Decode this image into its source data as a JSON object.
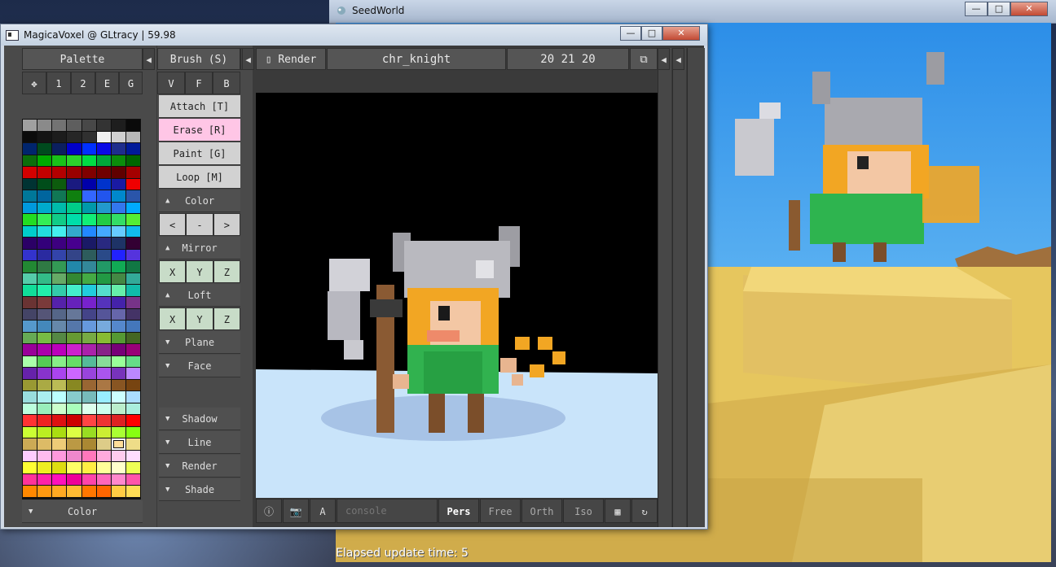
{
  "seedworld": {
    "title": "SeedWorld",
    "status": "Elapsed update time: 5",
    "controls": {
      "minimize": "—",
      "maximize": "□",
      "close": "✕"
    }
  },
  "magicavoxel": {
    "title": "MagicaVoxel @ GLtracy | 59.98",
    "controls": {
      "minimize": "—",
      "maximize": "□",
      "close": "✕"
    },
    "palette": {
      "header": "Palette",
      "tabs": [
        "1",
        "2",
        "E",
        "G"
      ],
      "footer": "Color",
      "selected_index": 222,
      "colors": [
        "#a0a0a0",
        "#8a8a8a",
        "#737373",
        "#5e5e5e",
        "#484848",
        "#333333",
        "#1e1e1e",
        "#0a0a0a",
        "#0b0b0b",
        "#141414",
        "#1c1c1c",
        "#262626",
        "#303030",
        "#f0f0f0",
        "#d0d0d0",
        "#b8b8b8",
        "#00256d",
        "#004a1e",
        "#0b1f5e",
        "#0000c8",
        "#0030ff",
        "#0a0ae6",
        "#1e2d8c",
        "#001a99",
        "#0b6e0b",
        "#00aa00",
        "#19c219",
        "#2bd22b",
        "#00dd44",
        "#00a83a",
        "#0b8c0b",
        "#006600",
        "#d40000",
        "#c40000",
        "#b30000",
        "#990000",
        "#800000",
        "#700000",
        "#600000",
        "#a40000",
        "#003333",
        "#004d1a",
        "#0d5c0d",
        "#1a1a80",
        "#0000aa",
        "#0033cc",
        "#1a1aa3",
        "#f00000",
        "#007799",
        "#00659e",
        "#117755",
        "#0f7f0f",
        "#3366ff",
        "#2255ee",
        "#0088cc",
        "#2a55aa",
        "#0099dd",
        "#00aacc",
        "#00bbaa",
        "#00cc88",
        "#0099aa",
        "#2299cc",
        "#3377ee",
        "#00aaff",
        "#22dd22",
        "#33ee55",
        "#11cc88",
        "#00ddaa",
        "#11ee77",
        "#22cc44",
        "#33dd66",
        "#55ee33",
        "#00cccc",
        "#22dddd",
        "#44eeee",
        "#33aacc",
        "#2288ff",
        "#44aaff",
        "#66ccff",
        "#11bbee",
        "#2b0066",
        "#33007a",
        "#3d0080",
        "#47008f",
        "#1a1a66",
        "#292980",
        "#1e3366",
        "#330033",
        "#3333cc",
        "#2a2aa0",
        "#3344aa",
        "#334488",
        "#2d5c5c",
        "#2a4a88",
        "#2222ff",
        "#5533dd",
        "#228833",
        "#2f7a44",
        "#339955",
        "#2288aa",
        "#338899",
        "#229966",
        "#11aa55",
        "#117744",
        "#55ccaa",
        "#33bb88",
        "#66aa66",
        "#338833",
        "#44aa44",
        "#229944",
        "#448844",
        "#33aa99",
        "#11dd99",
        "#22eeaa",
        "#33ccaa",
        "#44eecc",
        "#22ccdd",
        "#55ddcc",
        "#66eeaa",
        "#11bbaa",
        "#6a3333",
        "#7a3a3a",
        "#5522aa",
        "#6622bb",
        "#7722cc",
        "#5533bb",
        "#4422aa",
        "#773388",
        "#444466",
        "#555577",
        "#556688",
        "#667799",
        "#444488",
        "#555599",
        "#6666aa",
        "#443366",
        "#5599cc",
        "#4488bb",
        "#6688aa",
        "#5577aa",
        "#6699dd",
        "#77aadd",
        "#5588cc",
        "#4477bb",
        "#66aa55",
        "#77bb44",
        "#558844",
        "#669933",
        "#77aa44",
        "#88bb33",
        "#559933",
        "#446622",
        "#990099",
        "#aa00aa",
        "#bb00bb",
        "#cc22cc",
        "#aa22aa",
        "#882288",
        "#770077",
        "#990077",
        "#aaffaa",
        "#55cc55",
        "#88ee88",
        "#66dd66",
        "#55bb99",
        "#88dd99",
        "#99ff99",
        "#66dd88",
        "#6622aa",
        "#8833cc",
        "#aa44ee",
        "#cc66ff",
        "#9944dd",
        "#aa55ee",
        "#7733bb",
        "#bb88ff",
        "#999933",
        "#aaaa44",
        "#bbbb55",
        "#888822",
        "#996633",
        "#aa7744",
        "#885522",
        "#774411",
        "#99dddd",
        "#aaeeee",
        "#bbffff",
        "#88cccc",
        "#77bbbb",
        "#99eeff",
        "#ccffff",
        "#aaddff",
        "#bbffdd",
        "#99eebb",
        "#ccffcc",
        "#aaffbb",
        "#ddffee",
        "#ccffee",
        "#bbeecc",
        "#aaeedd",
        "#ff3333",
        "#ee2222",
        "#dd1111",
        "#cc0000",
        "#ff4444",
        "#ee3333",
        "#dd2222",
        "#ff0000",
        "#ccff33",
        "#bbee22",
        "#aadd11",
        "#ddff44",
        "#99dd22",
        "#ccee33",
        "#aaff33",
        "#88ff11",
        "#ccaa55",
        "#ddbb66",
        "#eecc77",
        "#bb9944",
        "#aa8833",
        "#ddcc88",
        "#ffdd99",
        "#eedd88",
        "#ffccff",
        "#ffbbee",
        "#ff99dd",
        "#ee88cc",
        "#ff77bb",
        "#ffaadd",
        "#ffccee",
        "#ffddff",
        "#ffff33",
        "#eeee22",
        "#dddd11",
        "#ffff66",
        "#ffee44",
        "#ffff99",
        "#ffffcc",
        "#eeff55",
        "#ff3399",
        "#ff22aa",
        "#ff11bb",
        "#ee0099",
        "#ff44aa",
        "#ff66bb",
        "#ff88cc",
        "#ff55aa",
        "#ff8800",
        "#ff9911",
        "#ffaa22",
        "#ffbb33",
        "#ff7700",
        "#ff6600",
        "#ffcc44",
        "#ffdd55",
        "#ff6666",
        "#ff7777",
        "#ff8888",
        "#ff5555",
        "#ee6666",
        "#ff9999",
        "#ffaaaa",
        "#ffbbbb",
        "#ffe0b0",
        "#ffd08a",
        "#ffc070",
        "#ffb050",
        "#ffe8c0",
        "#fff0d0",
        "#fff8e0",
        "#fff8f0"
      ]
    },
    "brush": {
      "header": "Brush (S)",
      "tabs": [
        "V",
        "F",
        "B"
      ],
      "modes": [
        "Attach [T]",
        "Erase  [R]",
        "Paint  [G]",
        "Loop   [M]"
      ],
      "color": {
        "label": "Color",
        "buttons": [
          "<",
          "-",
          ">"
        ]
      },
      "mirror": {
        "label": "Mirror",
        "axes": [
          "X",
          "Y",
          "Z"
        ]
      },
      "loft": {
        "label": "Loft",
        "axes": [
          "X",
          "Y",
          "Z"
        ]
      },
      "plane": "Plane",
      "face": "Face",
      "shadow": "Shadow",
      "line": "Line",
      "render": "Render",
      "shade": "Shade"
    },
    "view": {
      "render_label": "Render",
      "model_name": "chr_knight",
      "dims": "20 21 20",
      "console_placeholder": "console",
      "a_label": "A",
      "modes": [
        "Pers",
        "Free",
        "Orth",
        "Iso"
      ],
      "active_mode": "Pers"
    }
  }
}
